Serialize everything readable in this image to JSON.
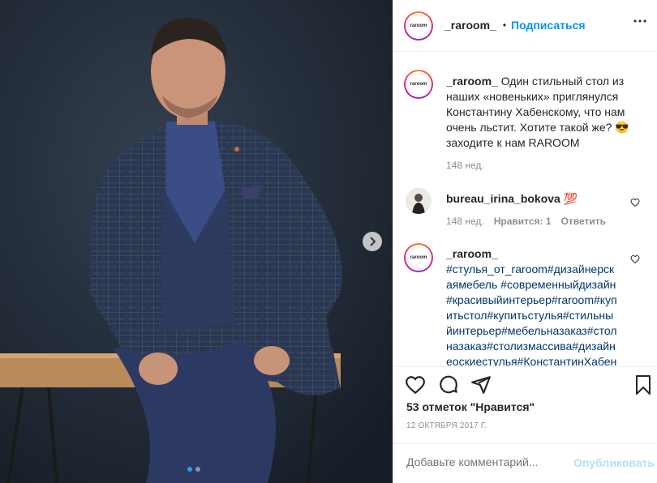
{
  "post": {
    "author": "_raroom_",
    "follow_label": "Подписаться",
    "avatar_text": "raroom"
  },
  "caption": {
    "author": "_raroom_",
    "text": "Один стильный стол из наших «новеньких» приглянулся Константину Хабенскому, что нам очень льстит. Хотите такой же? 😎 заходите к нам RAROOM",
    "age": "148 нед."
  },
  "comments": [
    {
      "author": "bureau_irina_bokova",
      "text": "💯",
      "age": "148 нед.",
      "likes": "Нравится: 1",
      "reply": "Ответить"
    },
    {
      "author": "_raroom_",
      "text": "#стулья_от_raroom#дизайнерскаямебель #современныйдизайн #красивыйинтерьер#raroom#купитьстол#купитьстулья#стильныйинтерьер#мебельназаказ#столназаказ#столизмассива#дизайнеоскиестулья#КонстантинХабен"
    }
  ],
  "stats": {
    "likes": "53 отметок \"Нравится\"",
    "date": "12 ОКТЯБРЯ 2017 Г."
  },
  "compose": {
    "placeholder": "Добавьте комментарий...",
    "publish_label": "Опубликовать"
  },
  "carousel": {
    "current": 1,
    "total": 2
  },
  "colors": {
    "accent": "#0095f6",
    "muted": "#8e8e8e",
    "photo_bg": "#1f2835"
  }
}
